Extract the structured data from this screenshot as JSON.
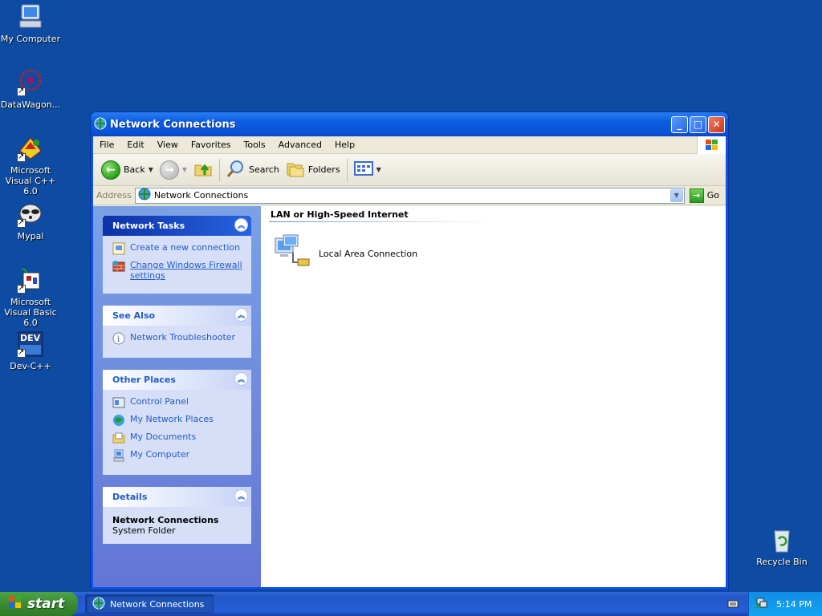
{
  "desktop": {
    "icons": [
      {
        "label": "My Computer"
      },
      {
        "label": "DataWagon..."
      },
      {
        "label": "Microsoft Visual C++ 6.0"
      },
      {
        "label": "Mypal"
      },
      {
        "label": "Microsoft Visual Basic 6.0"
      },
      {
        "label": "Dev-C++"
      },
      {
        "label": "Recycle Bin"
      }
    ],
    "devicon_text": "DEV"
  },
  "window": {
    "title": "Network Connections",
    "menu": [
      "File",
      "Edit",
      "View",
      "Favorites",
      "Tools",
      "Advanced",
      "Help"
    ],
    "toolbar": {
      "back_label": "Back",
      "search_label": "Search",
      "folders_label": "Folders"
    },
    "address": {
      "label": "Address",
      "value": "Network Connections",
      "go_label": "Go"
    },
    "taskpane": {
      "network_tasks": {
        "title": "Network Tasks",
        "items": [
          "Create a new connection",
          "Change Windows Firewall settings"
        ]
      },
      "see_also": {
        "title": "See Also",
        "items": [
          "Network Troubleshooter"
        ]
      },
      "other_places": {
        "title": "Other Places",
        "items": [
          "Control Panel",
          "My Network Places",
          "My Documents",
          "My Computer"
        ]
      },
      "details": {
        "title": "Details",
        "name": "Network Connections",
        "type": "System Folder"
      }
    },
    "content": {
      "group_header": "LAN or High-Speed Internet",
      "items": [
        "Local Area Connection"
      ]
    }
  },
  "taskbar": {
    "start_label": "start",
    "task_label": "Network Connections",
    "clock": "5:14 PM"
  },
  "colors": {
    "desktop": "#0d4ca2",
    "titlebar": "#0a5ce0",
    "taskpane": "#6f8ee0"
  }
}
